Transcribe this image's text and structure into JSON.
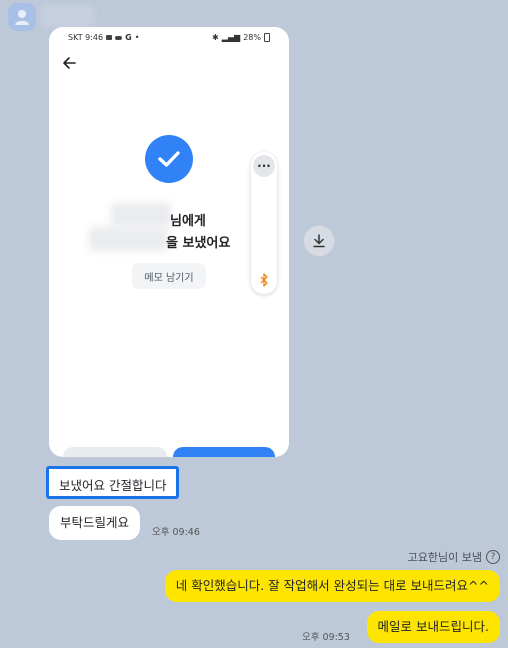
{
  "chat": {
    "incoming": [
      {
        "text": "보냈어요 간절합니다"
      },
      {
        "text": "부탁드릴게요",
        "time": "오후 09:46"
      }
    ],
    "outgoing": {
      "sender_label": "고요한님이 보냄",
      "messages": [
        {
          "text": "네 확인했습니다. 잘 작업해서 완성되는 대로 보내드려요^^"
        },
        {
          "text": "메일로 보내드립니다.",
          "time": "오후 09:53"
        }
      ]
    }
  },
  "screenshot": {
    "status_left": "SKT 9:46",
    "status_g": "G",
    "status_battery": "28%",
    "message_line1": "님에게",
    "message_line2": "을 보냈어요",
    "memo_button": "메모 남기기",
    "accent_color": "#3182f6"
  },
  "colors": {
    "background": "#bdc8d8",
    "my_bubble": "#fee500",
    "highlight_border": "#1a73e8"
  },
  "icons": {
    "avatar": "person-icon",
    "download": "download-icon",
    "back": "back-arrow-icon",
    "check": "check-icon",
    "more": "more-dots-icon",
    "bluetooth": "bluetooth-icon",
    "info": "info-icon"
  }
}
